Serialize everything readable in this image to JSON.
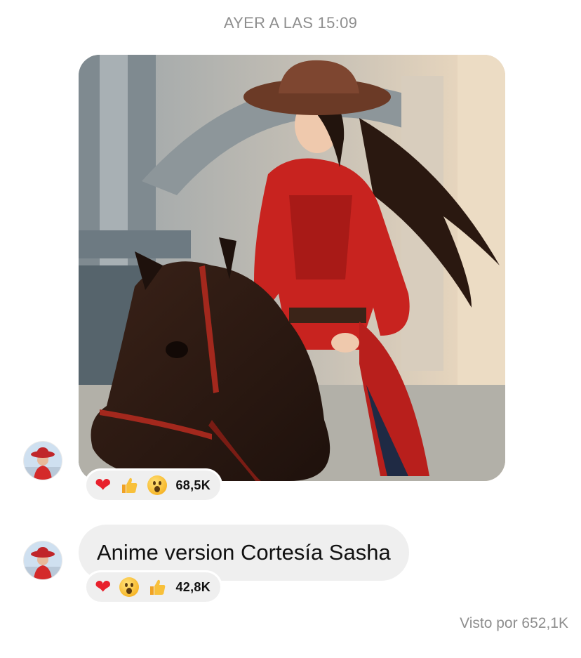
{
  "thread": {
    "timestamp": "AYER A LAS 15:09"
  },
  "messages": [
    {
      "type": "image",
      "image_description_icon": "cowgirl-on-horse-photo",
      "reactions": {
        "emojis": [
          "heart",
          "thumbs-up",
          "surprised-face"
        ],
        "count": "68,5K"
      }
    },
    {
      "type": "text",
      "text": "Anime version Cortesía Sasha",
      "reactions": {
        "emojis": [
          "heart",
          "surprised-face",
          "thumbs-up"
        ],
        "count": "42,8K"
      }
    }
  ],
  "footer": {
    "seen": "Visto por 652,1K"
  },
  "colors": {
    "bubble": "#efefef",
    "meta_text": "#8e8e8e",
    "heart": "#e8202c"
  }
}
